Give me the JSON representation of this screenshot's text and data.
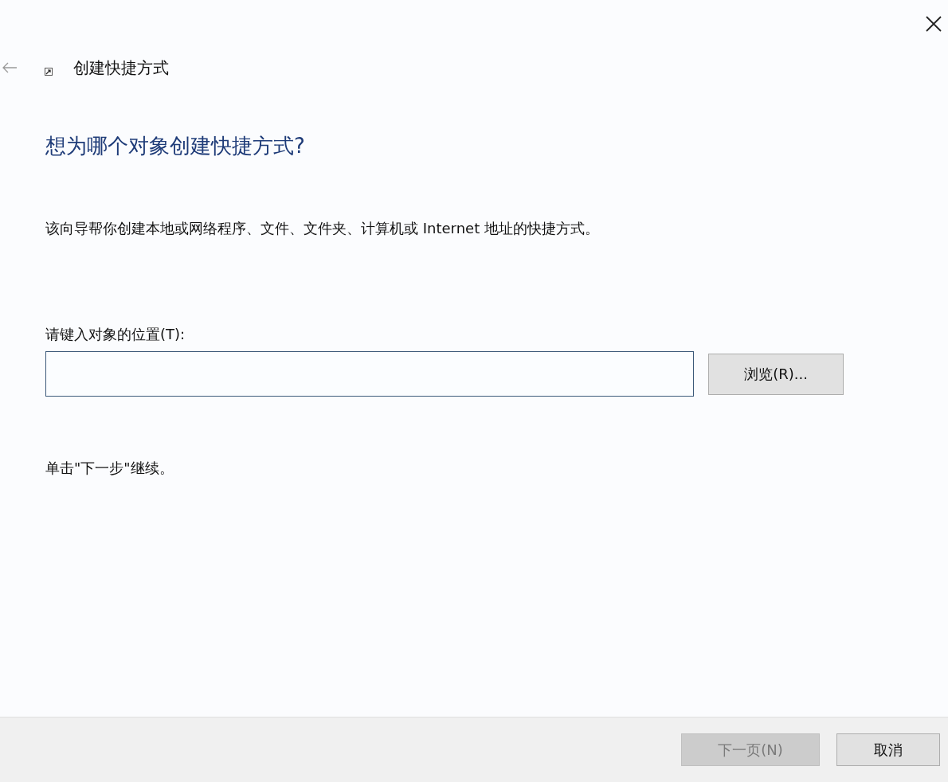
{
  "window": {
    "title": "创建快捷方式"
  },
  "heading": "想为哪个对象创建快捷方式?",
  "description": "该向导帮你创建本地或网络程序、文件、文件夹、计算机或 Internet 地址的快捷方式。",
  "location": {
    "label": "请键入对象的位置(T):",
    "browse_button": "浏览(R)..."
  },
  "hint": "单击\"下一步\"继续。",
  "buttons": [
    {
      "label": "下一页(N)",
      "disabled": true
    },
    {
      "label": "取消",
      "disabled": false
    }
  ]
}
